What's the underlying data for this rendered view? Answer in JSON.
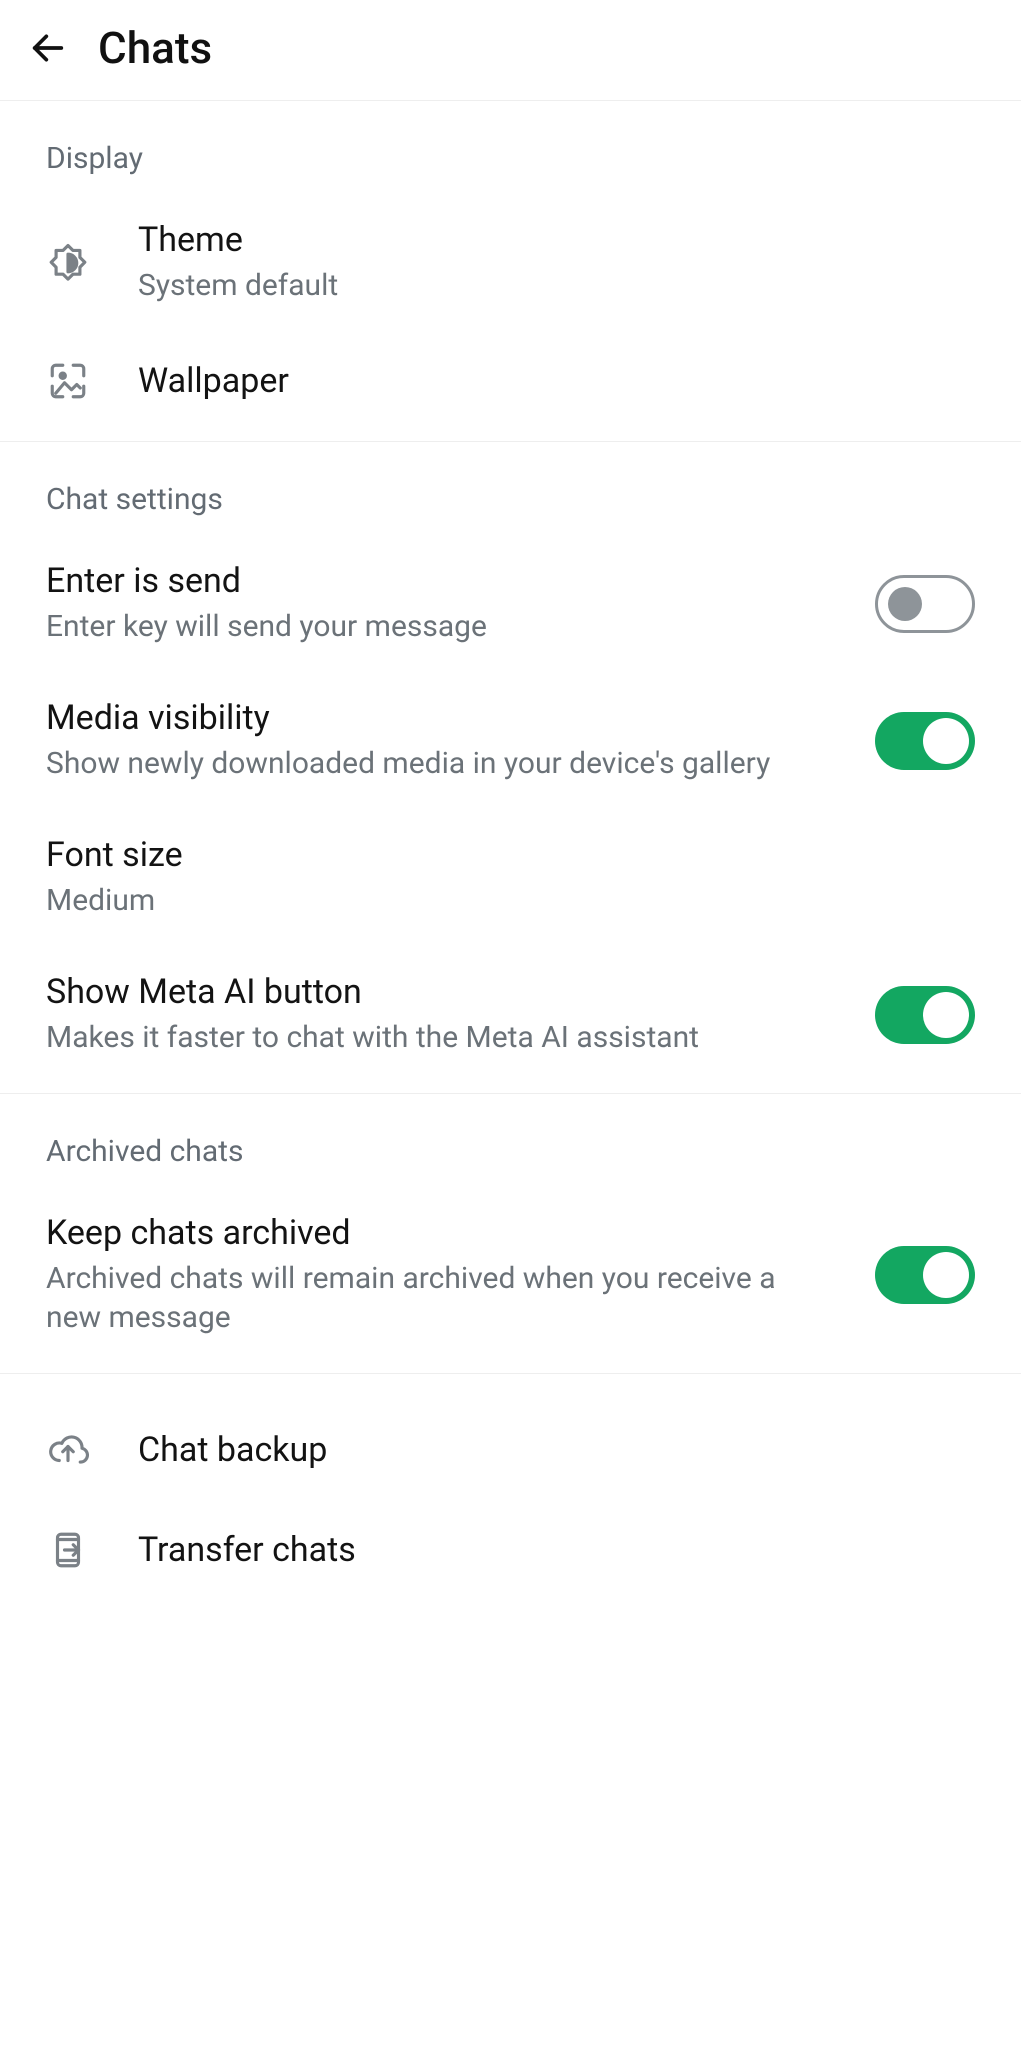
{
  "header": {
    "title": "Chats"
  },
  "sections": {
    "display": {
      "title": "Display",
      "theme": {
        "label": "Theme",
        "value": "System default"
      },
      "wallpaper": {
        "label": "Wallpaper"
      }
    },
    "chat_settings": {
      "title": "Chat settings",
      "enter_is_send": {
        "label": "Enter is send",
        "desc": "Enter key will send your message",
        "on": false
      },
      "media_visibility": {
        "label": "Media visibility",
        "desc": "Show newly downloaded media in your device's gallery",
        "on": true
      },
      "font_size": {
        "label": "Font size",
        "value": "Medium"
      },
      "show_meta_ai": {
        "label": "Show Meta AI button",
        "desc": "Makes it faster to chat with the Meta AI assistant",
        "on": true
      }
    },
    "archived": {
      "title": "Archived chats",
      "keep_archived": {
        "label": "Keep chats archived",
        "desc": "Archived chats will remain archived when you receive a new message",
        "on": true
      }
    },
    "footer": {
      "chat_backup": {
        "label": "Chat backup"
      },
      "transfer_chats": {
        "label": "Transfer chats"
      }
    }
  },
  "colors": {
    "accent": "#13a761",
    "text_secondary": "#6b7278"
  }
}
